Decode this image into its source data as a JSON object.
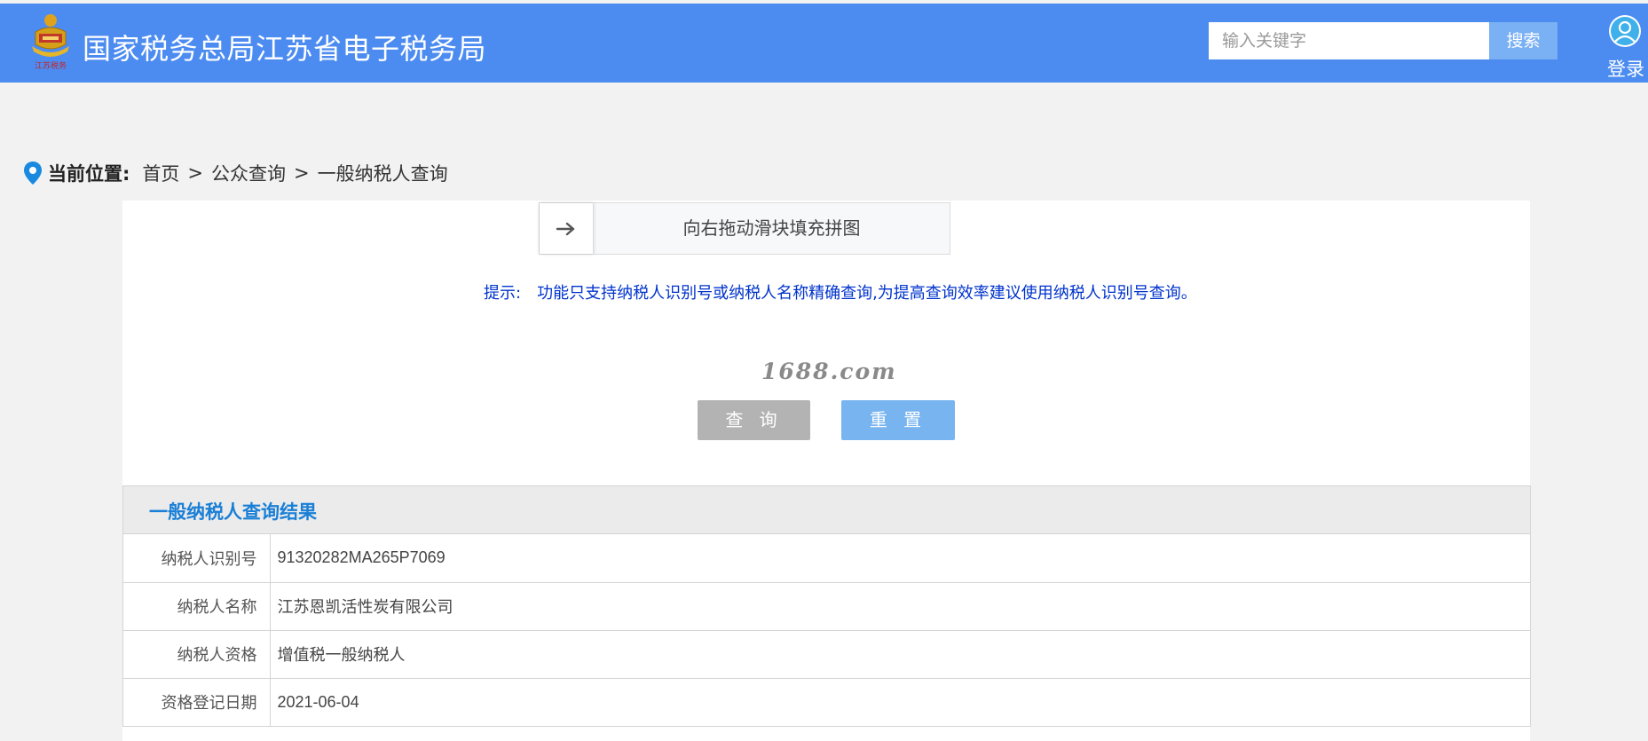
{
  "header": {
    "logo_caption": "江苏税务",
    "site_title": "国家税务总局江苏省电子税务局",
    "search": {
      "placeholder": "输入关键字",
      "value": "",
      "button_label": "搜索"
    },
    "login_label": "登录"
  },
  "breadcrumb": {
    "label": "当前位置:",
    "items": [
      "首页",
      "公众查询",
      "一般纳税人查询"
    ],
    "separator": ">"
  },
  "captcha": {
    "slider_text": "向右拖动滑块填充拼图",
    "handle_icon": "arrow-right-icon"
  },
  "tip": {
    "label": "提示:",
    "text": "功能只支持纳税人识别号或纳税人名称精确查询,为提高查询效率建议使用纳税人识别号查询。"
  },
  "watermark": "1688.com",
  "buttons": {
    "query": "查 询",
    "reset": "重 置"
  },
  "result": {
    "title": "一般纳税人查询结果",
    "rows": [
      {
        "key": "纳税人识别号",
        "value": "91320282MA265P7069"
      },
      {
        "key": "纳税人名称",
        "value": "江苏恩凯活性炭有限公司"
      },
      {
        "key": "纳税人资格",
        "value": "增值税一般纳税人"
      },
      {
        "key": "资格登记日期",
        "value": "2021-06-04"
      }
    ]
  },
  "colors": {
    "header_bg": "#4c8cf1",
    "search_button": "#7ab0f4",
    "tip_text": "#0033cc",
    "result_title": "#1a7fd6",
    "query_button": "#b3b3b3",
    "reset_button": "#78b4f0"
  }
}
